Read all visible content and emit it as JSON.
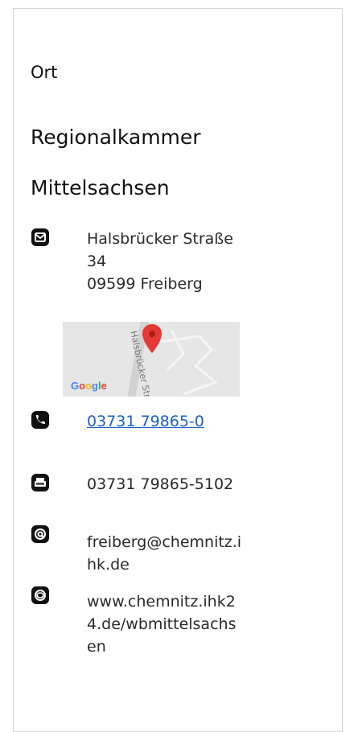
{
  "section": {
    "label": "Ort",
    "title_line1": "Regionalkammer",
    "title_line2": "Mittelsachsen"
  },
  "address": {
    "icon": "mail-icon",
    "street": "Halsbrücker Straße",
    "number": "34",
    "city": "09599 Freiberg"
  },
  "map": {
    "logo": "Google",
    "street_label": "Halsbrücker Str."
  },
  "contacts": {
    "phone": {
      "icon": "phone-icon",
      "value": "03731 79865-0"
    },
    "fax": {
      "icon": "fax-icon",
      "value": "03731 79865-5102"
    },
    "email": {
      "icon": "at-icon",
      "line1": "freiberg@chemnitz.i",
      "line2": "hk.de"
    },
    "website": {
      "icon": "web-icon",
      "line1": "www.chemnitz.ihk2",
      "line2": "4.de/wbmittelsachs",
      "line3": "en"
    }
  },
  "colors": {
    "link": "#1a60c6",
    "map_pin": "#e53935",
    "google_blue": "#4285F4",
    "google_red": "#EA4335",
    "google_yellow": "#FBBC05",
    "google_green": "#34A853"
  }
}
